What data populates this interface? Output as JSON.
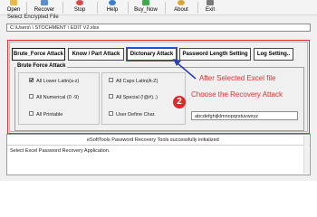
{
  "toolbar": {
    "buttons": [
      {
        "label": "Open",
        "color": "#e8b84a"
      },
      {
        "label": "Recover",
        "color": "#5a8fd6"
      },
      {
        "label": "Stop",
        "color": "#d64a4a"
      },
      {
        "label": "Help",
        "color": "#3c7fd0"
      },
      {
        "label": "Buy_Now",
        "color": "#3faa4a"
      },
      {
        "label": "About",
        "color": "#d8a73a"
      },
      {
        "label": "Exit",
        "color": "#7a7a7a"
      }
    ]
  },
  "file": {
    "label": "Select Encrypted File",
    "path": "C:\\Users\\                    \\ STOCHMENT \\ EDIT V2.xlsx"
  },
  "tabs": [
    {
      "label": "Brute_Force Attack"
    },
    {
      "label": "Know / Part Attack"
    },
    {
      "label": "Dictonary Attack"
    },
    {
      "label": "Password Length Setting"
    },
    {
      "label": "Log Setting.."
    }
  ],
  "group": {
    "title": "Brute Force Attack",
    "options": [
      {
        "label": "All Lower Latin(a-z)",
        "checked": true
      },
      {
        "label": "All Caps Latin(A-Z)",
        "checked": false
      },
      {
        "label": "All Numerical (0 -9)",
        "checked": false
      },
      {
        "label": "All Special (!@#)..)",
        "checked": false
      },
      {
        "label": "All Printable",
        "checked": false
      },
      {
        "label": "User Define Char.",
        "checked": false
      }
    ],
    "charset": "abcdefghijklmnopqrstuvwxyz"
  },
  "annotation": {
    "line1": "After Selected Excel file",
    "line2": "Choose the Recovery Attack",
    "badge": "2",
    "color": "#e03030"
  },
  "log": {
    "header": "eSoftTools Password Recovery Tools successfully initialized",
    "message": "Select Excel Password Recovery Application."
  }
}
